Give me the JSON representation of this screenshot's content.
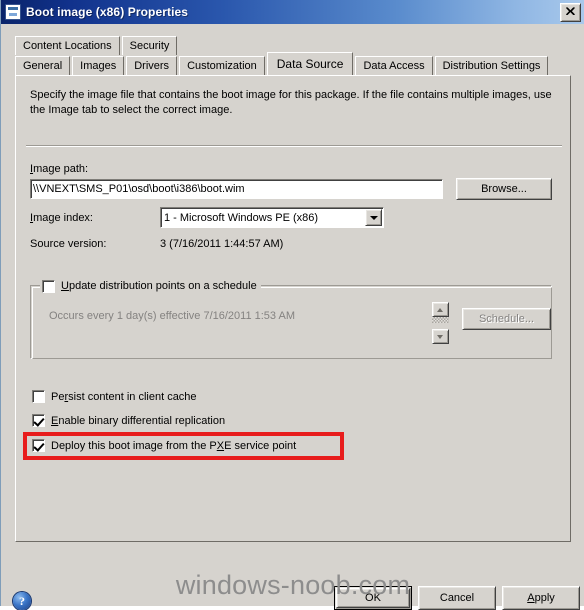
{
  "window": {
    "title": "Boot image (x86) Properties",
    "icon": "properties-window-icon",
    "close_label": "✕"
  },
  "tabs": {
    "row1": [
      {
        "label": "Content Locations",
        "active": false
      },
      {
        "label": "Security",
        "active": false
      }
    ],
    "row2": [
      {
        "label": "General",
        "active": false
      },
      {
        "label": "Images",
        "active": false
      },
      {
        "label": "Drivers",
        "active": false
      },
      {
        "label": "Customization",
        "active": false
      },
      {
        "label": "Data Source",
        "active": true
      },
      {
        "label": "Data Access",
        "active": false
      },
      {
        "label": "Distribution Settings",
        "active": false
      }
    ]
  },
  "panel": {
    "description": "Specify the image file that contains the boot image for this package. If the file contains multiple images, use the Image tab to select the correct image.",
    "image_path": {
      "label": "Image path:",
      "label_accel": "I",
      "value": "\\\\VNEXT\\SMS_P01\\osd\\boot\\i386\\boot.wim",
      "browse_label": "Browse...",
      "browse_accel": "B"
    },
    "image_index": {
      "label": "Image index:",
      "label_accel": "I",
      "value": "1 - Microsoft Windows PE (x86)"
    },
    "source_version": {
      "label": "Source version:",
      "value": "3 (7/16/2011 1:44:57 AM)"
    },
    "schedule_group": {
      "checkbox_label": "Update distribution points on a schedule",
      "checkbox_accel": "U",
      "checked": false,
      "schedule_text": "Occurs every 1 day(s) effective 7/16/2011 1:53 AM",
      "schedule_button": "Schedule...",
      "schedule_button_accel": "h",
      "enabled": false
    },
    "options": [
      {
        "label": "Persist content in client cache",
        "accel": "r",
        "checked": false,
        "highlighted": false
      },
      {
        "label": "Enable binary differential replication",
        "accel": "E",
        "checked": true,
        "highlighted": false
      },
      {
        "label": "Deploy this boot image from the PXE service point",
        "accel": "X",
        "checked": true,
        "highlighted": true
      }
    ]
  },
  "footer": {
    "help_label": "?",
    "ok_label": "OK",
    "cancel_label": "Cancel",
    "apply_label": "Apply",
    "apply_accel": "A"
  },
  "watermark": "windows-noob.com",
  "colors": {
    "dialog_face": "#d6d3ce",
    "title_gradient_start": "#0a246a",
    "title_gradient_end": "#a9c9ec",
    "highlight_red": "#e81c1c",
    "disabled_text": "#848280"
  }
}
